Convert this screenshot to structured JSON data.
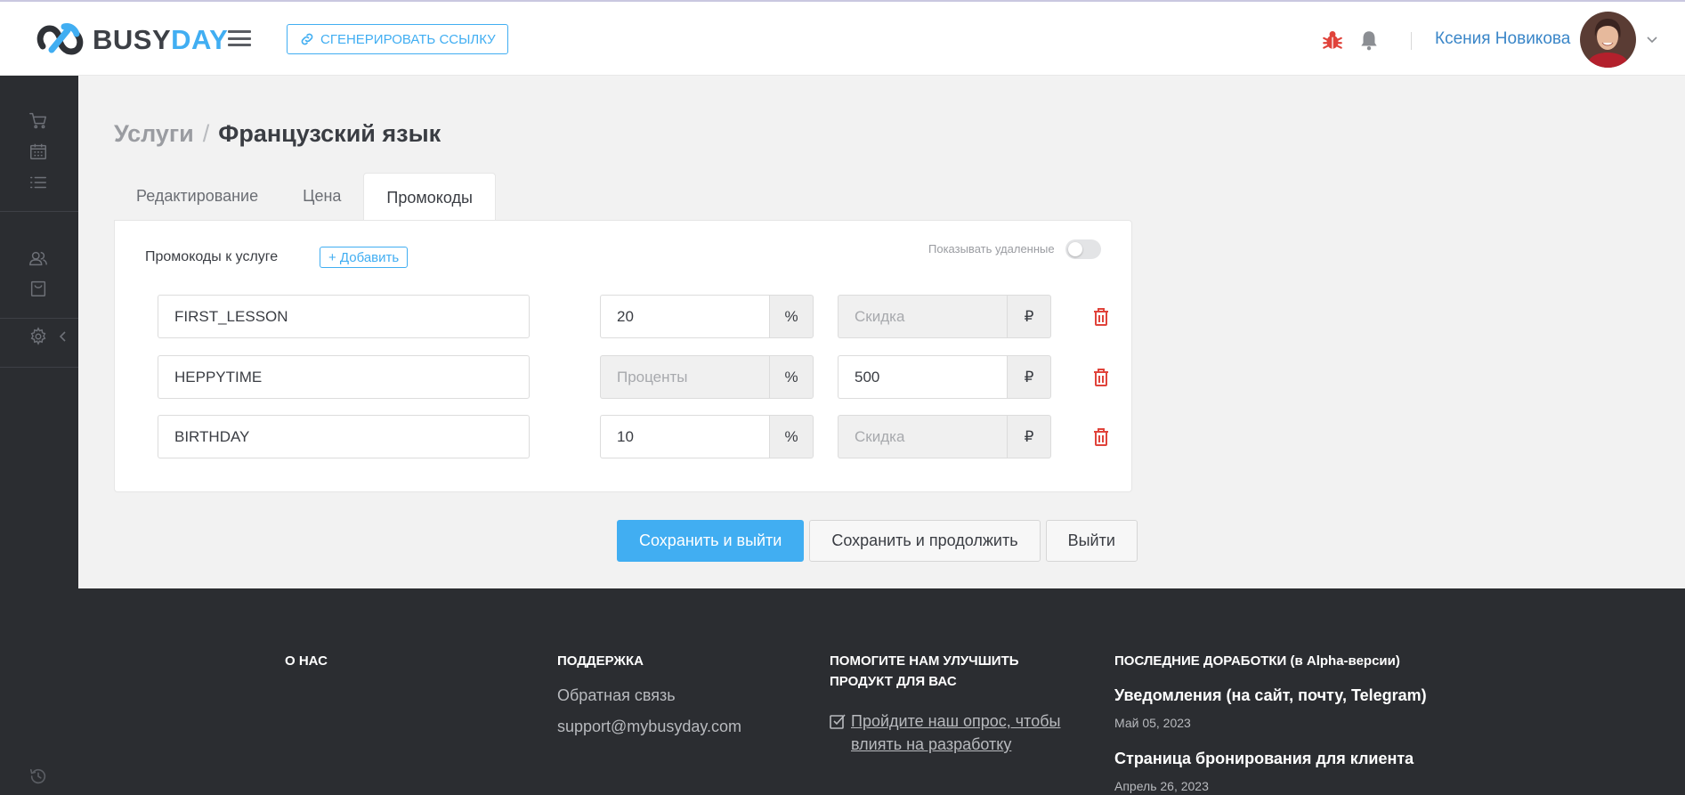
{
  "header": {
    "logo_busy": "BUSY",
    "logo_day": "DAY",
    "generate_link_label": "СГЕНЕРИРОВАТЬ ССЫЛКУ",
    "user_name": "Ксения Новикова"
  },
  "breadcrumb": {
    "parent": "Услуги",
    "separator": "/",
    "current": "Французский язык"
  },
  "tabs": [
    {
      "label": "Редактирование",
      "active": false
    },
    {
      "label": "Цена",
      "active": false
    },
    {
      "label": "Промокоды",
      "active": true
    }
  ],
  "promos": {
    "title": "Промокоды к услуге",
    "add_label": "+ Добавить",
    "show_deleted_label": "Показывать удаленные",
    "percent_symbol": "%",
    "ruble_symbol": "₽",
    "percent_placeholder": "Проценты",
    "discount_placeholder": "Скидка",
    "rows": [
      {
        "code": "FIRST_LESSON",
        "percent": "20",
        "discount": ""
      },
      {
        "code": "HEPPYTIME",
        "percent": "",
        "discount": "500"
      },
      {
        "code": "BIRTHDAY",
        "percent": "10",
        "discount": ""
      }
    ]
  },
  "actions": {
    "save_exit": "Сохранить и выйти",
    "save_continue": "Сохранить и продолжить",
    "exit": "Выйти"
  },
  "footer": {
    "about": {
      "heading": "О НАС"
    },
    "support": {
      "heading": "ПОДДЕРЖКА",
      "feedback": "Обратная связь",
      "email": "support@mybusyday.com"
    },
    "improve": {
      "heading_line1": "ПОМОГИТЕ НАМ УЛУЧШИТЬ",
      "heading_line2": "ПРОДУКТ ДЛЯ ВАС",
      "survey_line1": "Пройдите наш опрос, чтобы",
      "survey_line2": "влиять на разработку"
    },
    "news": {
      "heading": "ПОСЛЕДНИЕ ДОРАБОТКИ (в Alpha-версии)",
      "items": [
        {
          "title": "Уведомления (на сайт, почту, Telegram)",
          "date": "Май 05, 2023"
        },
        {
          "title": "Страница бронирования для клиента",
          "date": "Апрель 26, 2023"
        }
      ]
    }
  },
  "colors": {
    "accent": "#41aef2",
    "dark": "#2b2d31",
    "danger": "#e0433b"
  },
  "icons": [
    "link-icon",
    "bug-icon",
    "bell-icon",
    "cart-icon",
    "calendar-icon",
    "list-icon",
    "users-icon",
    "bag-icon",
    "gear-icon",
    "chevron-left-icon",
    "history-icon",
    "trash-icon",
    "checkbox-icon",
    "chevron-down-icon"
  ]
}
